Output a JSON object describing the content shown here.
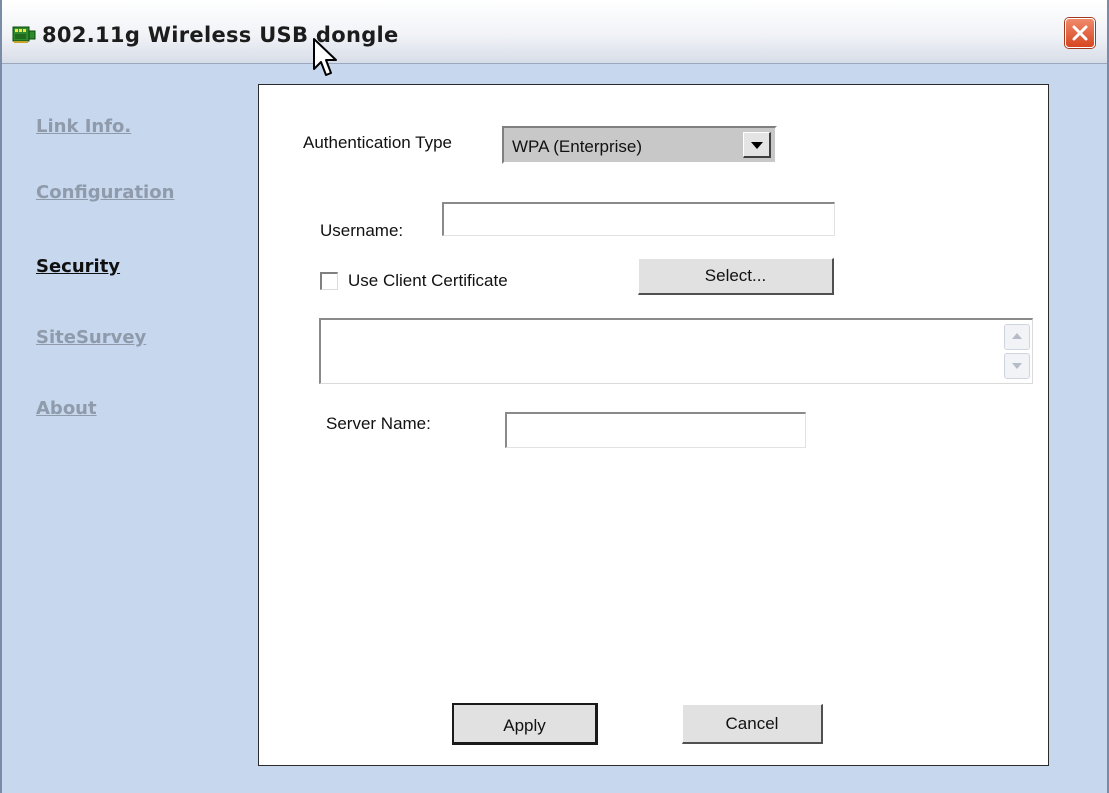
{
  "window": {
    "title": "802.11g Wireless USB dongle"
  },
  "sidebar": {
    "items": [
      {
        "label": "Link Info.",
        "active": false
      },
      {
        "label": "Configuration",
        "active": false
      },
      {
        "label": "Security",
        "active": true
      },
      {
        "label": "SiteSurvey",
        "active": false
      },
      {
        "label": "About",
        "active": false
      }
    ]
  },
  "security": {
    "auth_type_label": "Authentication Type",
    "auth_type_value": "WPA (Enterprise)",
    "username_label": "Username:",
    "username_value": "",
    "use_cert_label": "Use Client Certificate",
    "use_cert_checked": false,
    "select_button": "Select...",
    "certificate_text": "",
    "server_name_label": "Server Name:",
    "server_name_value": ""
  },
  "footer": {
    "apply_label": "Apply",
    "cancel_label": "Cancel"
  },
  "icons": {
    "app": "network-card-icon",
    "close": "close-icon",
    "cursor": "mouse-pointer-icon"
  },
  "colors": {
    "titlebar": "#f1f3f7",
    "background": "#c6d7ee",
    "close": "#d6451f",
    "link_inactive": "#8f9aab",
    "link_active": "#101010"
  }
}
